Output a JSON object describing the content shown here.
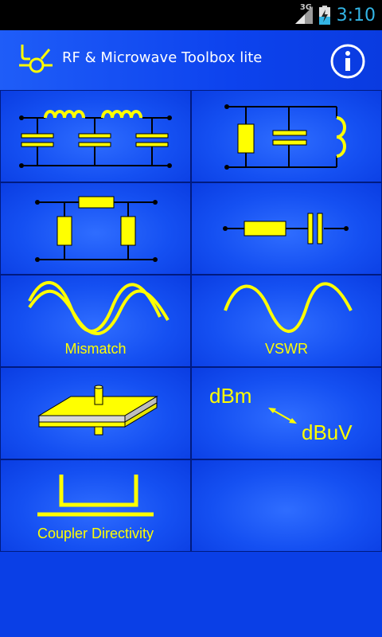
{
  "status_bar": {
    "network": "3G",
    "time": "3:10"
  },
  "app_bar": {
    "title": "RF  &  Microwave Toolbox lite",
    "info_icon": "info-icon",
    "logo_icon": "rf-logo-icon"
  },
  "tiles": [
    {
      "icon": "lc-filter-icon",
      "label": ""
    },
    {
      "icon": "resonator-icon",
      "label": ""
    },
    {
      "icon": "attenuator-icon",
      "label": ""
    },
    {
      "icon": "series-rc-icon",
      "label": ""
    },
    {
      "icon": "mismatch-waves-icon",
      "label": "Mismatch"
    },
    {
      "icon": "vswr-wave-icon",
      "label": "VSWR"
    },
    {
      "icon": "microstrip-icon",
      "label": ""
    },
    {
      "icon": "dbm-dbuv-icon",
      "label": "",
      "text_a": "dBm",
      "text_b": "dBuV"
    },
    {
      "icon": "coupler-icon",
      "label": "Coupler Directivity"
    },
    {
      "icon": "",
      "label": ""
    }
  ],
  "colors": {
    "accent": "#ffff00",
    "background": "#0a3fe6",
    "status_clock": "#33b5e5"
  }
}
